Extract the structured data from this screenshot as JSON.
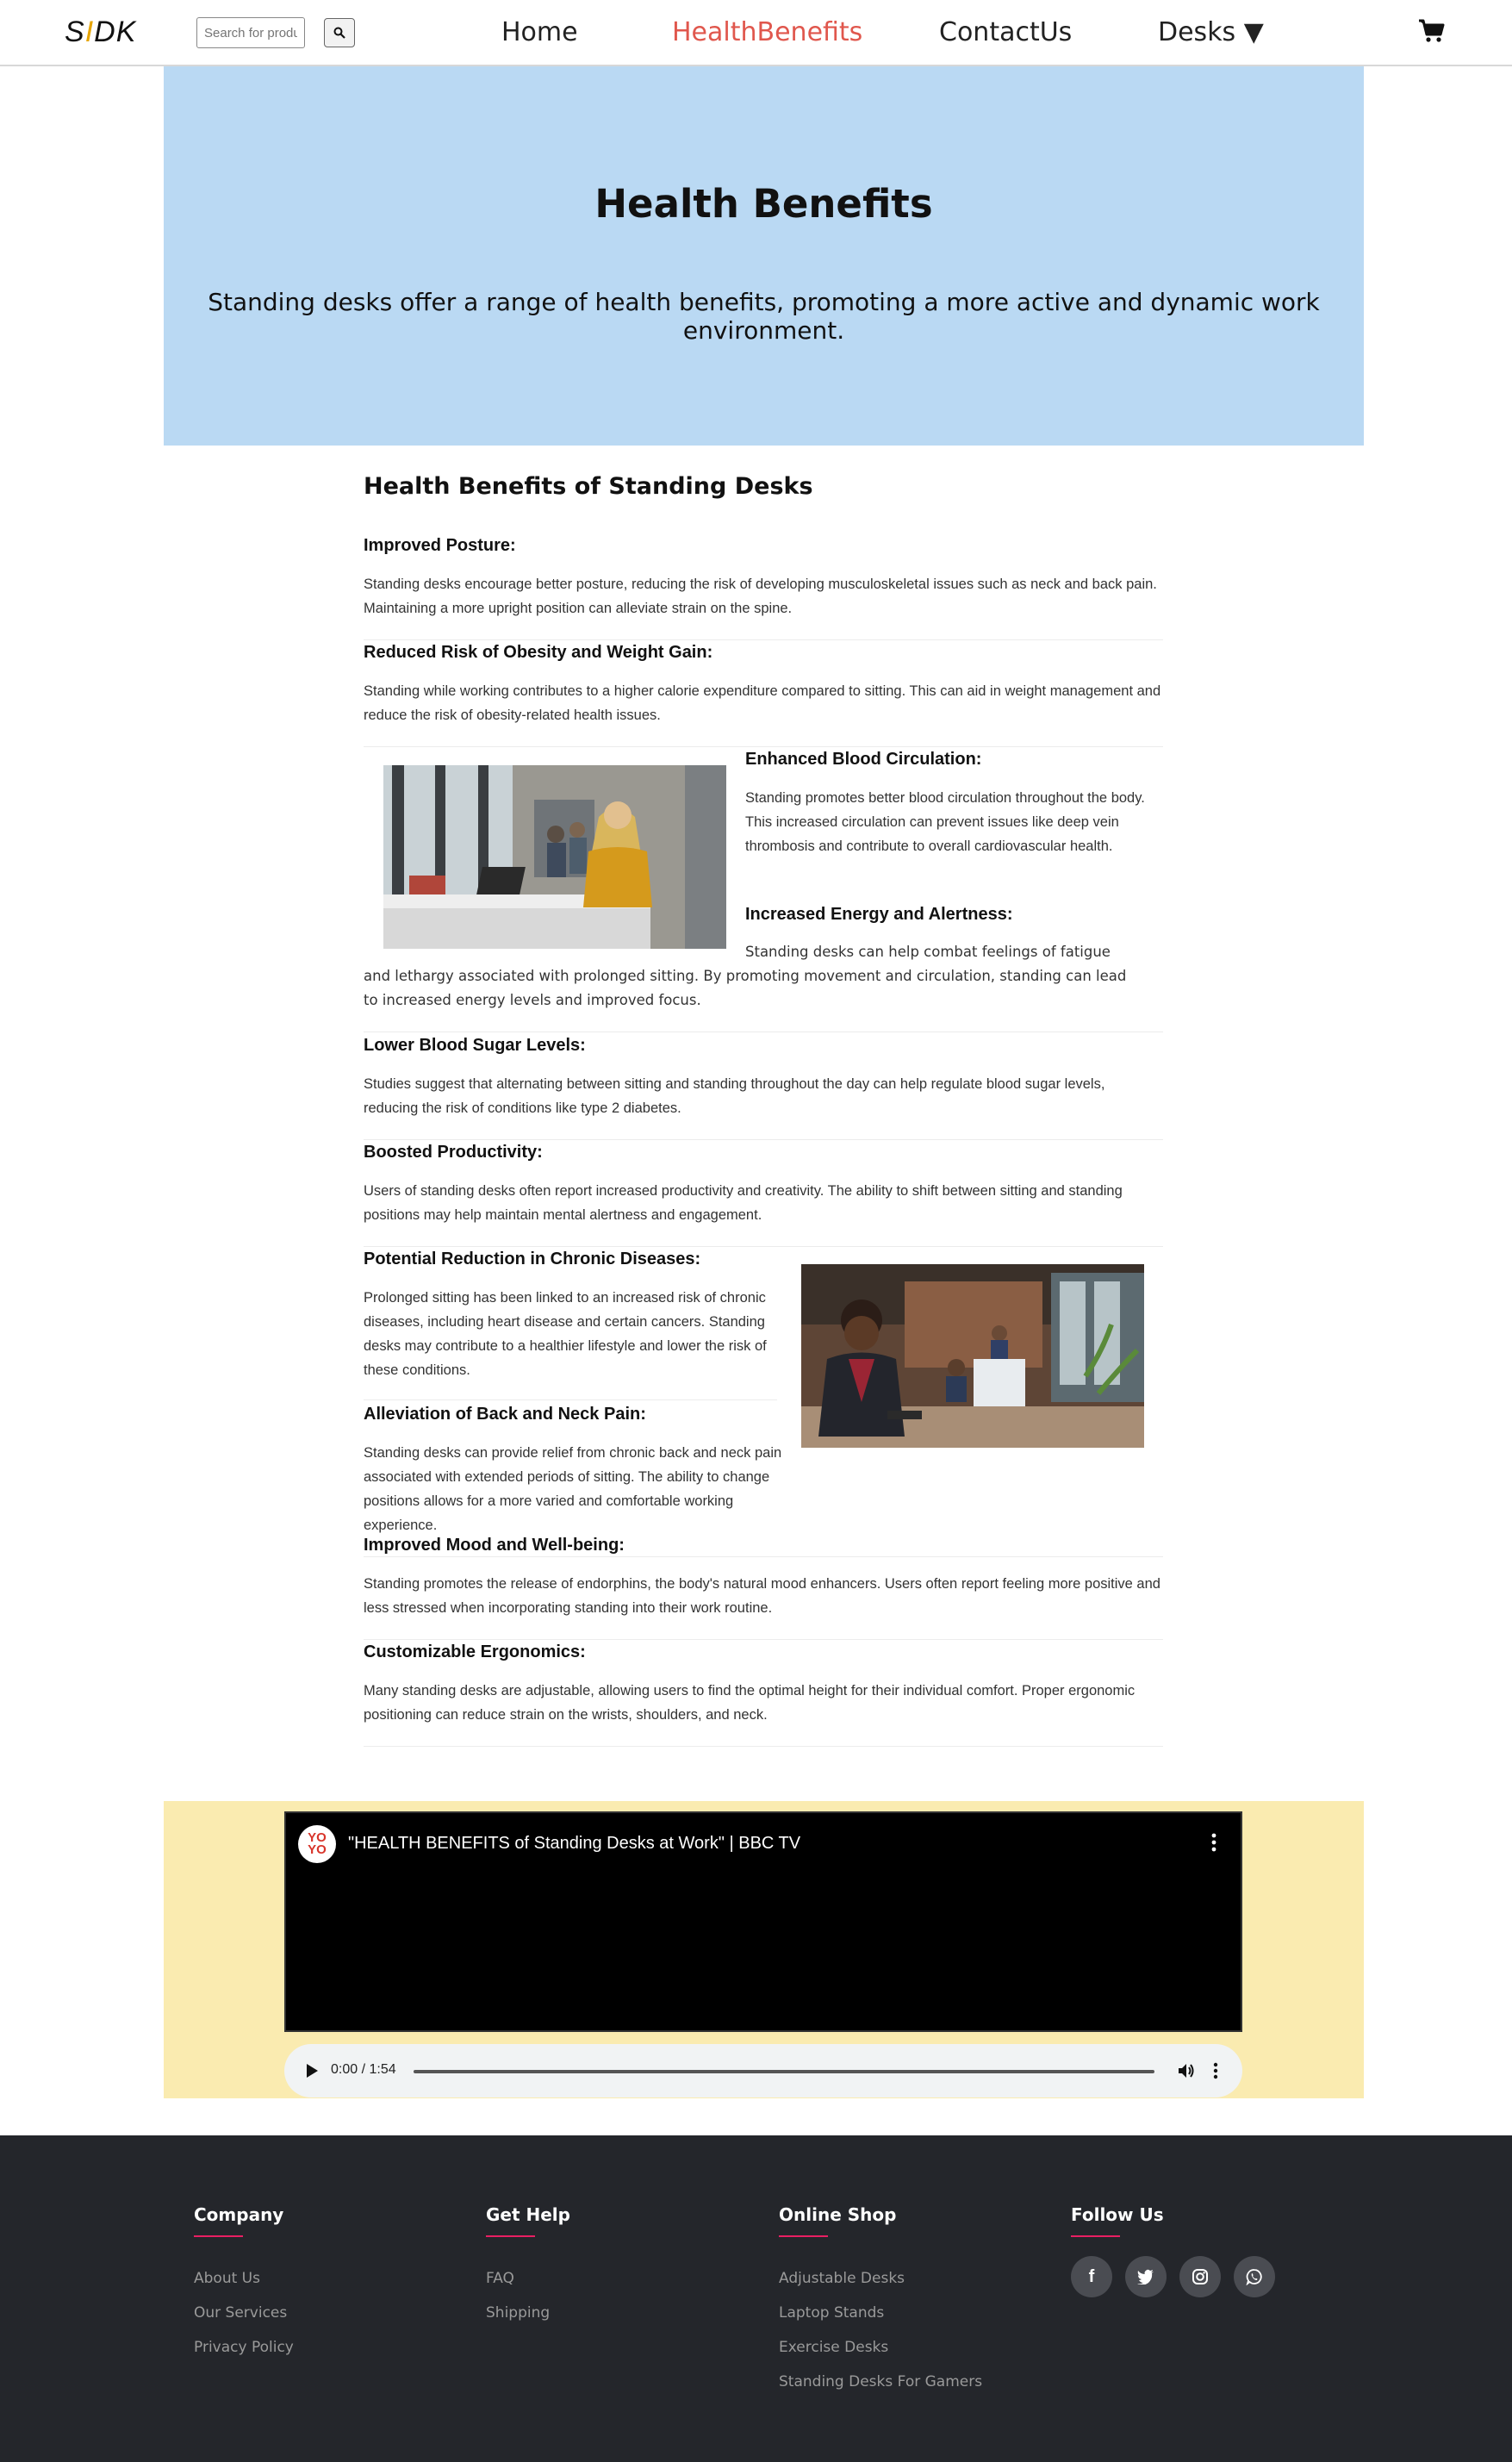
{
  "navbar": {
    "logo_s": "S",
    "logo_i": "I",
    "logo_dk": "DK",
    "search_placeholder": "Search for products",
    "links": [
      "Home",
      "HealthBenefits",
      "ContactUs",
      "Desks ▼"
    ]
  },
  "hero": {
    "title": "Health Benefits",
    "subtitle": "Standing desks offer a range of health benefits, promoting a more active and dynamic work environment."
  },
  "content": {
    "heading": "Health Benefits of Standing Desks",
    "sections": [
      {
        "title": "Improved Posture:",
        "text": "Standing desks encourage better posture, reducing the risk of developing musculoskeletal issues such as neck and back pain. Maintaining a more upright position can alleviate strain on the spine."
      },
      {
        "title": "Reduced Risk of Obesity and Weight Gain:",
        "text": "Standing while working contributes to a higher calorie expenditure compared to sitting. This can aid in weight management and reduce the risk of obesity-related health issues."
      },
      {
        "title": "Enhanced Blood Circulation:",
        "text": "Standing promotes better blood circulation throughout the body. This increased circulation can prevent issues like deep vein thrombosis and contribute to overall cardiovascular health."
      },
      {
        "title": "Increased Energy and Alertness:",
        "text": "Standing desks can help combat feelings of fatigue and lethargy associated with prolonged sitting. By promoting movement and circulation, standing can lead to increased energy levels and improved focus."
      },
      {
        "title": "Lower Blood Sugar Levels:",
        "text": "Studies suggest that alternating between sitting and standing throughout the day can help regulate blood sugar levels, reducing the risk of conditions like type 2 diabetes."
      },
      {
        "title": "Boosted Productivity:",
        "text": "Users of standing desks often report increased productivity and creativity. The ability to shift between sitting and standing positions may help maintain mental alertness and engagement."
      },
      {
        "title": "Potential Reduction in Chronic Diseases:",
        "text": "Prolonged sitting has been linked to an increased risk of chronic diseases, including heart disease and certain cancers. Standing desks may contribute to a healthier lifestyle and lower the risk of these conditions."
      },
      {
        "title": "Alleviation of Back and Neck Pain:",
        "text": "Standing desks can provide relief from chronic back and neck pain associated with extended periods of sitting. The ability to change positions allows for a more varied and comfortable working experience."
      },
      {
        "title": "Improved Mood and Well-being:",
        "text": "Standing promotes the release of endorphins, the body's natural mood enhancers. Users often report feeling more positive and less stressed when incorporating standing into their work routine."
      },
      {
        "title": "Customizable Ergonomics:",
        "text": "Many standing desks are adjustable, allowing users to find the optimal height for their individual comfort. Proper ergonomic positioning can reduce strain on the wrists, shoulders, and neck."
      }
    ]
  },
  "video": {
    "channel_badge_top": "YO",
    "channel_badge_bottom": "YO",
    "title": "\"HEALTH BENEFITS of Standing Desks at Work\" | BBC TV",
    "time": "0:00 / 1:54"
  },
  "footer": {
    "columns": [
      {
        "title": "Company",
        "links": [
          "About Us",
          "Our Services",
          "Privacy Policy"
        ]
      },
      {
        "title": "Get Help",
        "links": [
          "FAQ",
          "Shipping"
        ]
      },
      {
        "title": "Online Shop",
        "links": [
          "Adjustable Desks",
          "Laptop Stands",
          "Exercise Desks",
          "Standing Desks For Gamers"
        ]
      },
      {
        "title": "Follow Us",
        "socials": [
          "facebook-icon",
          "twitter-icon",
          "instagram-icon",
          "whatsapp-icon"
        ]
      }
    ]
  },
  "colors": {
    "accent": "#e0574d",
    "hero_bg": "#bad9f3",
    "video_band_bg": "#faebb0",
    "footer_bg": "#24262b",
    "footer_accent": "#e91e63"
  }
}
